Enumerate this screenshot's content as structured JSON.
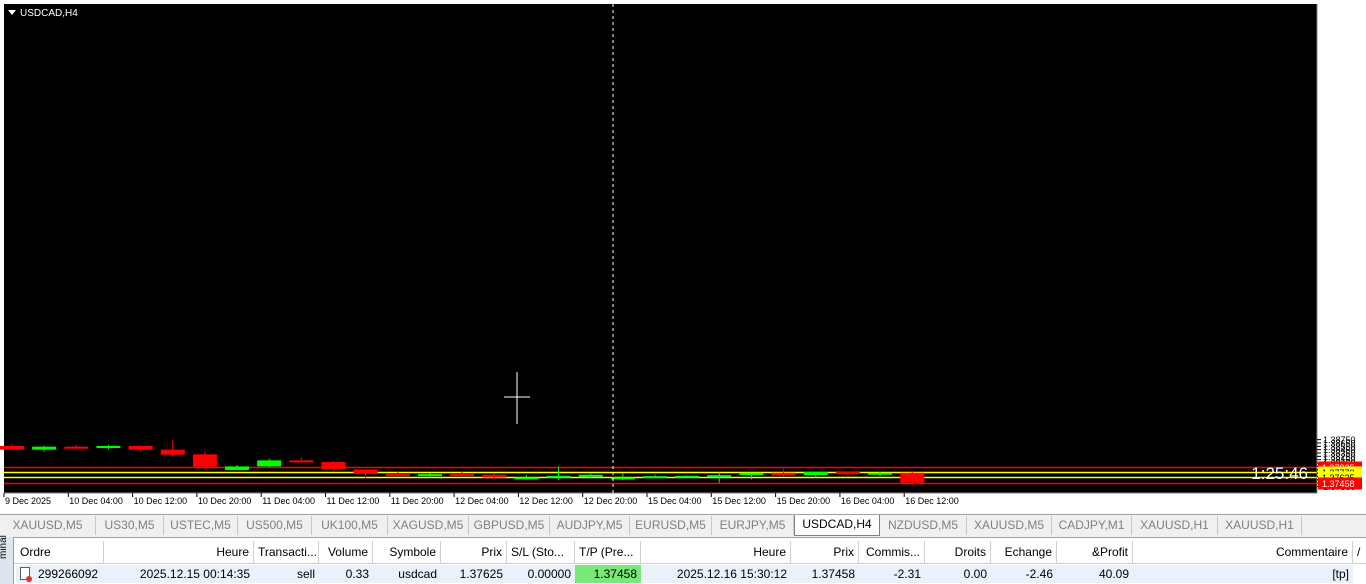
{
  "chart": {
    "title": "USDCAD,H4",
    "timer": "1:25:46",
    "colors": {
      "background": "#000000",
      "bull": "#00ff00",
      "bear": "#ff0000",
      "axis_bg": "#ffffff",
      "level_red": "#ff0000",
      "level_yellow": "#ffff00"
    }
  },
  "chart_data": {
    "type": "candlestick",
    "symbol": "USDCAD",
    "timeframe": "H4",
    "ylim": [
      1.3733,
      1.3882
    ],
    "y_ticks": [
      "1.38750",
      "1.38650",
      "1.38550",
      "1.38450",
      "1.38350",
      "1.38250",
      "1.38150",
      "1.38050",
      "1.37950",
      "1.37850",
      "1.37750",
      "1.37650",
      "1.37550",
      "1.37450",
      "1.37350"
    ],
    "x_ticks": [
      "9 Dec 2025",
      "10 Dec 04:00",
      "10 Dec 12:00",
      "10 Dec 20:00",
      "11 Dec 04:00",
      "11 Dec 12:00",
      "11 Dec 20:00",
      "12 Dec 04:00",
      "12 Dec 12:00",
      "12 Dec 20:00",
      "15 Dec 04:00",
      "15 Dec 12:00",
      "15 Dec 20:00",
      "16 Dec 04:00",
      "16 Dec 12:00"
    ],
    "candles": [
      {
        "o": 1.3856,
        "h": 1.3862,
        "l": 1.3845,
        "c": 1.3845
      },
      {
        "o": 1.3845,
        "h": 1.3857,
        "l": 1.3839,
        "c": 1.3854
      },
      {
        "o": 1.3854,
        "h": 1.3859,
        "l": 1.3852,
        "c": 1.3853
      },
      {
        "o": 1.3853,
        "h": 1.386,
        "l": 1.3846,
        "c": 1.3856
      },
      {
        "o": 1.3856,
        "h": 1.3858,
        "l": 1.3838,
        "c": 1.3845
      },
      {
        "o": 1.3845,
        "h": 1.3873,
        "l": 1.3826,
        "c": 1.383
      },
      {
        "o": 1.3831,
        "h": 1.3841,
        "l": 1.3784,
        "c": 1.3794
      },
      {
        "o": 1.3784,
        "h": 1.3799,
        "l": 1.3784,
        "c": 1.3795
      },
      {
        "o": 1.3795,
        "h": 1.3818,
        "l": 1.3793,
        "c": 1.3813
      },
      {
        "o": 1.3813,
        "h": 1.3823,
        "l": 1.3806,
        "c": 1.3807
      },
      {
        "o": 1.3808,
        "h": 1.3811,
        "l": 1.3781,
        "c": 1.3786
      },
      {
        "o": 1.3786,
        "h": 1.3786,
        "l": 1.3758,
        "c": 1.3772
      },
      {
        "o": 1.3772,
        "h": 1.378,
        "l": 1.3766,
        "c": 1.3769
      },
      {
        "o": 1.3767,
        "h": 1.3776,
        "l": 1.3761,
        "c": 1.3772
      },
      {
        "o": 1.3772,
        "h": 1.3779,
        "l": 1.3769,
        "c": 1.377
      },
      {
        "o": 1.377,
        "h": 1.3774,
        "l": 1.3757,
        "c": 1.3762
      },
      {
        "o": 1.3762,
        "h": 1.3769,
        "l": 1.3756,
        "c": 1.3762
      },
      {
        "o": 1.3763,
        "h": 1.3795,
        "l": 1.3755,
        "c": 1.3767
      },
      {
        "o": 1.3766,
        "h": 1.3773,
        "l": 1.3761,
        "c": 1.377
      },
      {
        "o": 1.3756,
        "h": 1.3775,
        "l": 1.3754,
        "c": 1.3762
      },
      {
        "o": 1.3762,
        "h": 1.377,
        "l": 1.376,
        "c": 1.3766
      },
      {
        "o": 1.3766,
        "h": 1.3768,
        "l": 1.376,
        "c": 1.3767
      },
      {
        "o": 1.3767,
        "h": 1.3777,
        "l": 1.3746,
        "c": 1.3769
      },
      {
        "o": 1.3769,
        "h": 1.3774,
        "l": 1.3756,
        "c": 1.3776
      },
      {
        "o": 1.3776,
        "h": 1.3788,
        "l": 1.3764,
        "c": 1.3768
      },
      {
        "o": 1.3769,
        "h": 1.378,
        "l": 1.3761,
        "c": 1.3779
      },
      {
        "o": 1.3779,
        "h": 1.3777,
        "l": 1.3766,
        "c": 1.3772
      },
      {
        "o": 1.3772,
        "h": 1.3779,
        "l": 1.3766,
        "c": 1.3776
      },
      {
        "o": 1.3776,
        "h": 1.378,
        "l": 1.3738,
        "c": 1.3746
      }
    ],
    "levels": [
      {
        "price": 1.37925,
        "label": "1.37925",
        "color": "#ff0000"
      },
      {
        "price": 1.3777,
        "label": "1.37770",
        "color": "#ffff00"
      },
      {
        "price": 1.37625,
        "label": "1.37625",
        "color": "#ffff00"
      },
      {
        "price": 1.37458,
        "label": "1.37458",
        "color": "#ff0000"
      }
    ]
  },
  "tabs": [
    "XAUUSD,M5",
    "US30,M5",
    "USTEC,M5",
    "US500,M5",
    "UK100,M5",
    "XAGUSD,M5",
    "GBPUSD,M5",
    "AUDJPY,M5",
    "EURUSD,M5",
    "EURJPY,M5",
    "USDCAD,H4",
    "NZDUSD,M5",
    "XAUUSD,M5",
    "CADJPY,M1",
    "XAUUSD,H1",
    "XAUUSD,H1"
  ],
  "active_tab_index": 10,
  "terminal": {
    "side_label": "minal",
    "columns": [
      "Ordre",
      "Heure",
      "Transacti...",
      "Volume",
      "Symbole",
      "Prix",
      "S/L (Sto...",
      "T/P (Pre...",
      "Heure",
      "Prix",
      "Commis...",
      "Droits",
      "Echange",
      "&Profit",
      "Commentaire"
    ],
    "sort_indicator": "/",
    "row": {
      "ordre": "299266092",
      "heure": "2025.12.15 00:14:35",
      "transaction": "sell",
      "volume": "0.33",
      "symbole": "usdcad",
      "prix": "1.37625",
      "sl": "0.00000",
      "tp": "1.37458",
      "heure2": "2025.12.16 15:30:12",
      "prix2": "1.37458",
      "commission": "-2.31",
      "droits": "0.00",
      "echange": "-2.46",
      "profit": "40.09",
      "commentaire": "[tp]"
    }
  }
}
